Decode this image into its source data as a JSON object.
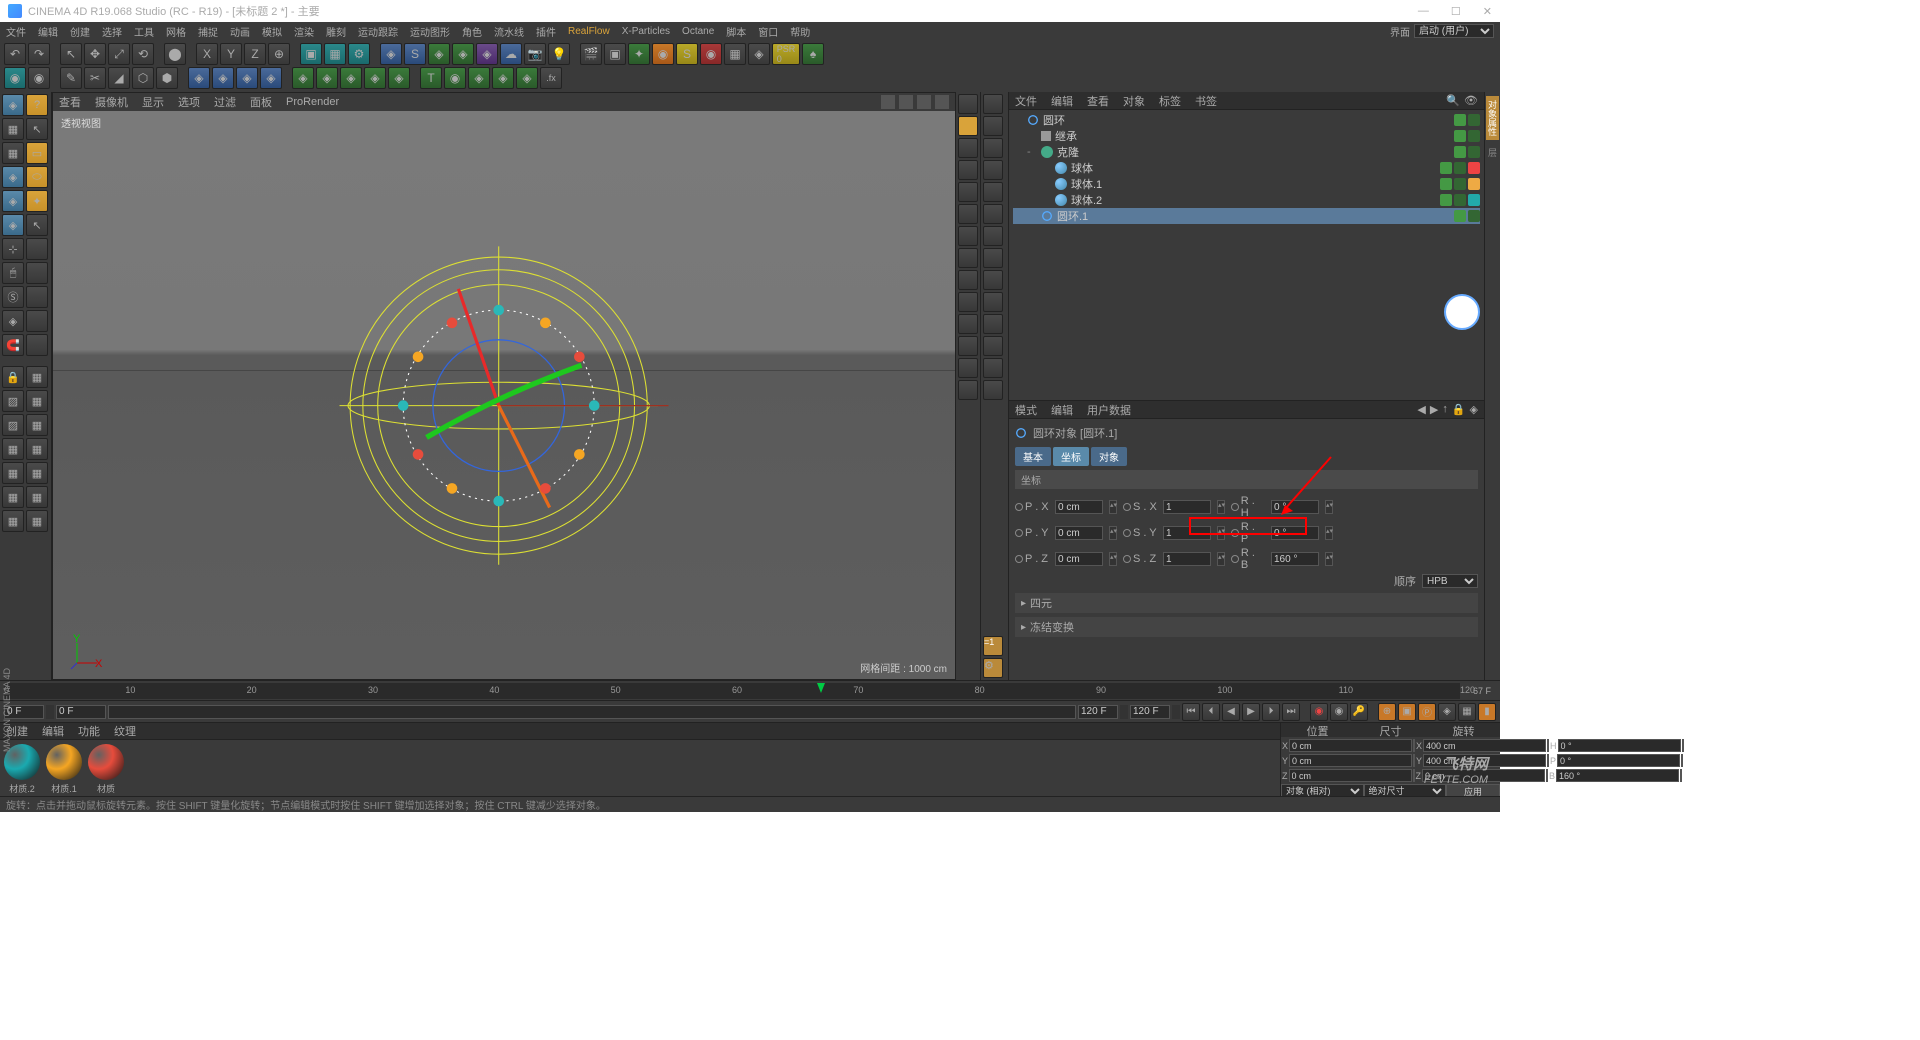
{
  "title": "CINEMA 4D R19.068 Studio (RC - R19) - [未标题 2 *] - 主要",
  "menu": [
    "文件",
    "编辑",
    "创建",
    "选择",
    "工具",
    "网格",
    "捕捉",
    "动画",
    "模拟",
    "渲染",
    "雕刻",
    "运动跟踪",
    "运动图形",
    "角色",
    "流水线",
    "插件",
    "RealFlow",
    "X-Particles",
    "Octane",
    "脚本",
    "窗口",
    "帮助"
  ],
  "layout": {
    "label": "界面",
    "value": "启动 (用户)"
  },
  "viewport": {
    "menu": [
      "查看",
      "摄像机",
      "显示",
      "选项",
      "过滤",
      "面板",
      "ProRender"
    ],
    "label": "透视视图",
    "info": "网格间距 : 1000 cm"
  },
  "obj_menu": [
    "文件",
    "编辑",
    "查看",
    "对象",
    "标签",
    "书签"
  ],
  "tree": [
    {
      "i": 0,
      "icon": "ring",
      "name": "圆环",
      "tags": [
        "v",
        "chk"
      ]
    },
    {
      "i": 1,
      "icon": "null",
      "name": "继承",
      "tags": [
        "v",
        "chk"
      ]
    },
    {
      "i": 1,
      "icon": "cloner",
      "name": "克隆",
      "tags": [
        "v",
        "chk"
      ],
      "exp": "-"
    },
    {
      "i": 2,
      "icon": "sphere",
      "name": "球体",
      "tags": [
        "v",
        "chk",
        "r"
      ]
    },
    {
      "i": 2,
      "icon": "sphere",
      "name": "球体.1",
      "tags": [
        "v",
        "chk",
        "o"
      ]
    },
    {
      "i": 2,
      "icon": "sphere",
      "name": "球体.2",
      "tags": [
        "v",
        "chk",
        "c"
      ]
    },
    {
      "i": 1,
      "icon": "ring",
      "name": "圆环.1",
      "tags": [
        "v",
        "chk"
      ],
      "sel": true
    }
  ],
  "attr": {
    "menu": [
      "模式",
      "编辑",
      "用户数据"
    ],
    "title": "圆环对象 [圆环.1]",
    "tabs": [
      "基本",
      "坐标",
      "对象"
    ],
    "sect": "坐标",
    "px": {
      "l": "P . X",
      "v": "0 cm"
    },
    "py": {
      "l": "P . Y",
      "v": "0 cm"
    },
    "pz": {
      "l": "P . Z",
      "v": "0 cm"
    },
    "sx": {
      "l": "S . X",
      "v": "1"
    },
    "sy": {
      "l": "S . Y",
      "v": "1"
    },
    "sz": {
      "l": "S . Z",
      "v": "1"
    },
    "rh": {
      "l": "R . H",
      "v": "0 °"
    },
    "rp": {
      "l": "R . P",
      "v": "0 °"
    },
    "rb": {
      "l": "R . B",
      "v": "160 °"
    },
    "order": {
      "l": "顺序",
      "v": "HPB"
    },
    "exp1": "四元",
    "exp2": "冻结变换"
  },
  "timeline": {
    "ticks": [
      0,
      10,
      20,
      30,
      40,
      50,
      60,
      70,
      80,
      90,
      100,
      110,
      120
    ],
    "cur": 67,
    "info": "67 F",
    "start": "0 F",
    "range": "0 F",
    "end1": "120 F",
    "end2": "120 F"
  },
  "mat": {
    "menu": [
      "创建",
      "编辑",
      "功能",
      "纹理"
    ],
    "items": [
      {
        "name": "材质.2",
        "c": "#1aaab0"
      },
      {
        "name": "材质.1",
        "c": "#f5a623"
      },
      {
        "name": "材质",
        "c": "#e74c3c"
      }
    ]
  },
  "coord": {
    "hdr": [
      "位置",
      "尺寸",
      "旋转"
    ],
    "rows": [
      {
        "a": "X",
        "p": "0 cm",
        "s": "400 cm",
        "r": "H",
        "rv": "0 °"
      },
      {
        "a": "Y",
        "p": "0 cm",
        "s": "400 cm",
        "r": "P",
        "rv": "0 °"
      },
      {
        "a": "Z",
        "p": "0 cm",
        "s": "0 cm",
        "r": "B",
        "rv": "160 °"
      }
    ],
    "mode1": "对象 (相对)",
    "mode2": "绝对尺寸",
    "apply": "应用"
  },
  "status": "旋转：点击并拖动鼠标旋转元素。按住 SHIFT 键量化旋转；节点编辑模式时按住 SHIFT 键增加选择对象；按住 CTRL 键减少选择对象。",
  "vtext": "MAXON CINEMA 4D",
  "watermark": {
    "l1": "飞特网",
    "l2": "FEVTE.COM"
  }
}
